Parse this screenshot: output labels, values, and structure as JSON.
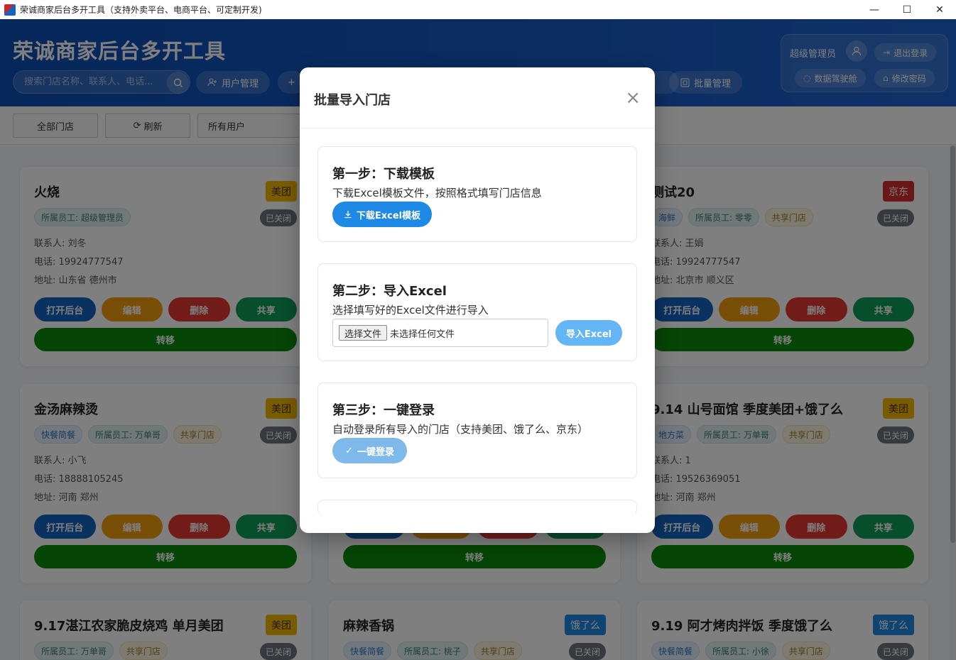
{
  "window": {
    "title": "荣诚商家后台多开工具（支持外卖平台、电商平台、可定制开发)",
    "minimize": "—",
    "maximize": "☐",
    "close": "✕"
  },
  "header": {
    "brand": "荣诚商家后台多开工具",
    "search_placeholder": "搜索门店名称、联系人、电话...",
    "user_mgmt": "用户管理",
    "batch_mgmt": "批量管理",
    "user_role": "超级管理员",
    "logout": "退出登录",
    "cockpit": "数据驾驶舱",
    "change_pwd": "修改密码"
  },
  "toolbar": {
    "all_stores": "全部门店",
    "refresh": "刷新",
    "all_users": "所有用户"
  },
  "cards": [
    {
      "title": "火烧",
      "platform": "美团",
      "tags": [
        "所属员工: 超级管理员"
      ],
      "status": "已关闭",
      "contact": "联系人: 刘冬",
      "phone": "电话: 19924777547",
      "address": "地址: 山东省 德州市"
    },
    {
      "title": "测试20",
      "platform": "京东",
      "tags": [
        "海鲜",
        "所属员工: 零零",
        "共享门店"
      ],
      "status": "已关闭",
      "contact": "联系人: 王娟",
      "phone": "电话: 19924777547",
      "address": "地址: 北京市 顺义区"
    },
    {
      "title": "金汤麻辣烫",
      "platform": "美团",
      "tags": [
        "快餐简餐",
        "所属员工: 万单哥",
        "共享门店"
      ],
      "status": "已关闭",
      "contact": "联系人: 小飞",
      "phone": "电话: 18888105245",
      "address": "地址: 河南 郑州"
    },
    {
      "title": "9.14 山号面馆 季度美团+饿了么",
      "platform": "美团",
      "tags": [
        "地方菜",
        "所属员工: 万单哥",
        "共享门店"
      ],
      "status": "已关闭",
      "contact": "联系人: 1",
      "phone": "电话: 19526369051",
      "address": "地址: 河南 郑州"
    },
    {
      "title": "9.17湛江农家脆皮烧鸡 单月美团",
      "platform": "美团",
      "tags": [
        "所属员工: 万单哥",
        "共享门店"
      ],
      "status": "已关闭"
    },
    {
      "title": "麻辣香锅",
      "platform": "饿了么",
      "tags": [
        "快餐简餐",
        "所属员工: 桃子",
        "共享门店"
      ],
      "status": "已关闭"
    },
    {
      "title": "9.19 阿才烤肉拌饭 季度饿了么",
      "platform": "饿了么",
      "tags": [
        "快餐简餐",
        "所属员工: 小徐",
        "共享门店"
      ],
      "status": "已关闭"
    }
  ],
  "card_actions": {
    "open": "打开后台",
    "edit": "编辑",
    "delete": "删除",
    "share": "共享",
    "transfer": "转移"
  },
  "modal": {
    "title": "批量导入门店",
    "close": "×",
    "step1": {
      "title": "第一步：下载模板",
      "desc": "下载Excel模板文件，按照格式填写门店信息",
      "button": "下载Excel模板"
    },
    "step2": {
      "title": "第二步：导入Excel",
      "desc": "选择填写好的Excel文件进行导入",
      "file_button": "选择文件",
      "file_status": "未选择任何文件",
      "button": "导入Excel"
    },
    "step3": {
      "title": "第三步：一键登录",
      "desc": "自动登录所有导入的门店（支持美团、饿了么、京东）",
      "button": "一键登录"
    }
  },
  "colors": {
    "header": "#0d4eb5",
    "meituan": "#f5b800",
    "jd": "#d32f2f",
    "ele": "#1e88e5",
    "open": "#1565c0",
    "edit": "#f29c0f",
    "delete": "#e53935",
    "share": "#0f9d58",
    "transfer": "#0a8a0a"
  }
}
